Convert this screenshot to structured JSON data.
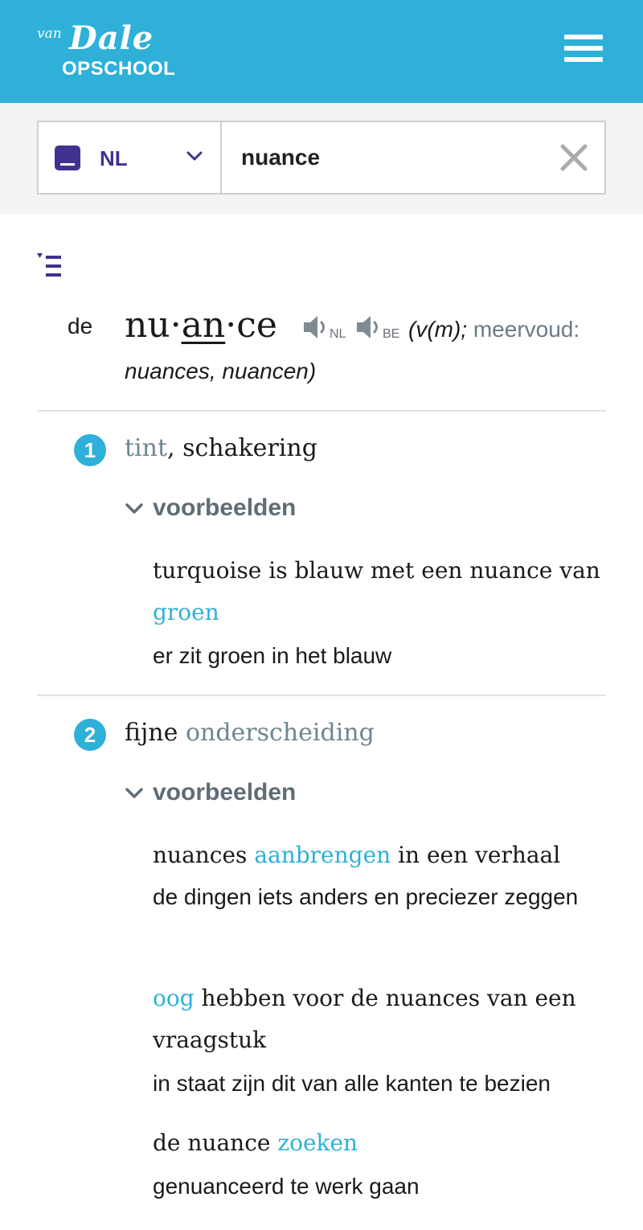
{
  "header": {
    "logo": {
      "van": "van",
      "dale": "Dale",
      "op": "OPSCHOOL"
    },
    "menu_icon": "hamburger-menu-icon",
    "bg_color": "#2eb0d8"
  },
  "search": {
    "lang_icon": "book-icon",
    "lang_code": "NL",
    "chevron_icon": "chevron-down-icon",
    "query": "nuance",
    "clear_icon": "close-icon"
  },
  "toc_icon": "table-of-contents-icon",
  "entry": {
    "article": "de",
    "syllables": [
      "nu",
      "·",
      "an",
      "·",
      "ce"
    ],
    "underlined_syllable": "an",
    "audio": [
      {
        "icon": "speaker-icon",
        "label": "NL"
      },
      {
        "icon": "speaker-icon",
        "label": "BE"
      }
    ],
    "gender": "(v(m);",
    "plural_label": "meervoud:",
    "plurals": "nuances, nuancen)"
  },
  "senses": [
    {
      "number": "1",
      "definition": {
        "link": "tint",
        "rest": ", schakering"
      },
      "examples_toggle": "voorbeelden",
      "examples": [
        {
          "pre": "turquoise is blauw met een nuance van ",
          "link": "groen",
          "post": "",
          "gloss": "er zit groen in het blauw"
        }
      ]
    },
    {
      "number": "2",
      "definition": {
        "pre": "fijne ",
        "link": "onderscheiding"
      },
      "examples_toggle": "voorbeelden",
      "examples": [
        {
          "pre": "nuances ",
          "link": "aanbrengen",
          "post": " in een verhaal",
          "gloss": "de dingen iets anders en preciezer zeggen"
        },
        {
          "pre": "",
          "link": "oog",
          "post": " hebben voor de nuances van een vraagstuk",
          "gloss": "in staat zijn dit van alle kanten te bezien"
        },
        {
          "pre": "de nuance ",
          "link": "zoeken",
          "post": "",
          "gloss": "genuanceerd te werk gaan"
        }
      ]
    }
  ],
  "colors": {
    "accent": "#2eb0d8",
    "brand": "#3f3290",
    "link_gray": "#6e8690"
  }
}
